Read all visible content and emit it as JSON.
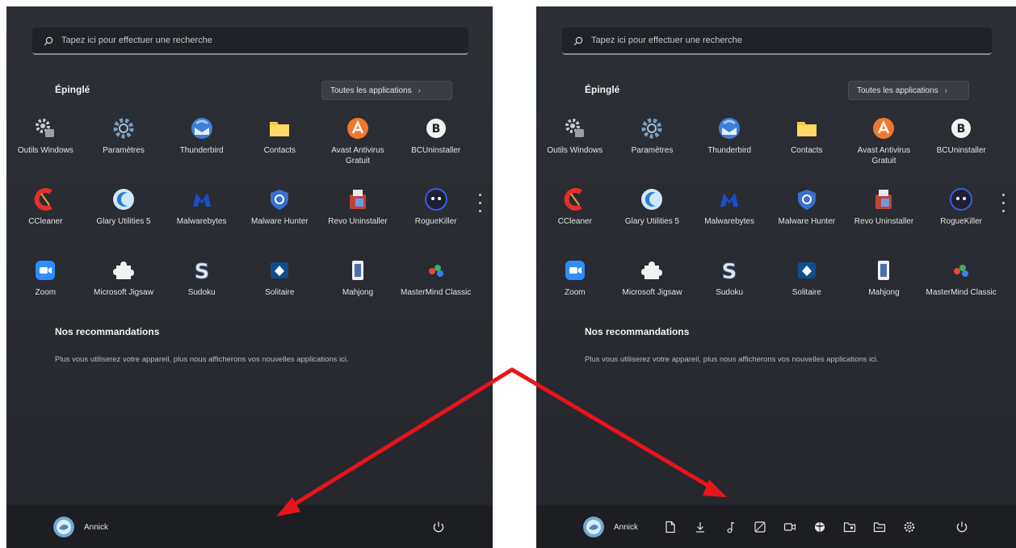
{
  "search": {
    "placeholder": "Tapez ici pour effectuer une recherche"
  },
  "pinned": {
    "title": "Épinglé",
    "all_apps_label": "Toutes les applications",
    "apps": [
      {
        "label": "Outils Windows",
        "icon": "windows-tools-icon"
      },
      {
        "label": "Paramètres",
        "icon": "settings-gear-icon"
      },
      {
        "label": "Thunderbird",
        "icon": "thunderbird-icon"
      },
      {
        "label": "Contacts",
        "icon": "folder-icon"
      },
      {
        "label": "Avast Antivirus Gratuit",
        "icon": "avast-icon"
      },
      {
        "label": "BCUninstaller",
        "icon": "bcuninstaller-icon"
      },
      {
        "label": "CCleaner",
        "icon": "ccleaner-icon"
      },
      {
        "label": "Glary Utilities 5",
        "icon": "glary-utilities-icon"
      },
      {
        "label": "Malwarebytes",
        "icon": "malwarebytes-icon"
      },
      {
        "label": "Malware Hunter",
        "icon": "malware-hunter-icon"
      },
      {
        "label": "Revo Uninstaller",
        "icon": "revo-uninstaller-icon"
      },
      {
        "label": "RogueKiller",
        "icon": "roguekiller-icon"
      },
      {
        "label": "Zoom",
        "icon": "zoom-icon"
      },
      {
        "label": "Microsoft Jigsaw",
        "icon": "jigsaw-icon"
      },
      {
        "label": "Sudoku",
        "icon": "sudoku-icon"
      },
      {
        "label": "Solitaire",
        "icon": "solitaire-icon"
      },
      {
        "label": "Mahjong",
        "icon": "mahjong-icon"
      },
      {
        "label": "MasterMind Classic",
        "icon": "mastermind-icon"
      }
    ]
  },
  "recommendations": {
    "title": "Nos recommandations",
    "text": "Plus vous utiliserez votre appareil, plus nous afficherons vos nouvelles applications ici."
  },
  "user": {
    "name": "Annick"
  },
  "shortcuts": [
    "documents-icon",
    "downloads-icon",
    "music-icon",
    "pictures-icon",
    "videos-icon",
    "network-icon",
    "personal-folder-icon",
    "file-explorer-icon",
    "settings-icon"
  ],
  "colors": {
    "arrow": "#e8141c",
    "accent": "#0078d4"
  }
}
